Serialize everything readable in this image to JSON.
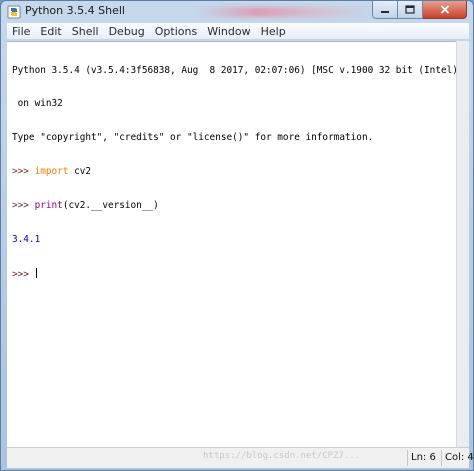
{
  "window": {
    "title": "Python 3.5.4 Shell"
  },
  "menu": {
    "items": [
      "File",
      "Edit",
      "Shell",
      "Debug",
      "Options",
      "Window",
      "Help"
    ]
  },
  "shell": {
    "banner_line1": "Python 3.5.4 (v3.5.4:3f56838, Aug  8 2017, 02:07:06) [MSC v.1900 32 bit (Intel)]",
    "banner_line2": " on win32",
    "banner_line3": "Type \"copyright\", \"credits\" or \"license()\" for more information.",
    "prompt": ">>> ",
    "cmd1_keyword": "import",
    "cmd1_rest": " cv2",
    "cmd2_builtin": "print",
    "cmd2_rest": "(cv2.__version__)",
    "result": "3.4.1",
    "final_prompt": ">>> "
  },
  "status": {
    "line": "Ln: 6",
    "col": "Col: 4",
    "watermark": "https://blog.csdn.net/CPZ7..."
  },
  "colors": {
    "prompt": "#7a1c1c",
    "keyword": "#ff7700",
    "builtin": "#900090",
    "output": "#0000c0"
  },
  "icons": {
    "app": "python-idle-icon",
    "minimize": "minimize-icon",
    "maximize": "maximize-icon",
    "close": "close-icon"
  }
}
